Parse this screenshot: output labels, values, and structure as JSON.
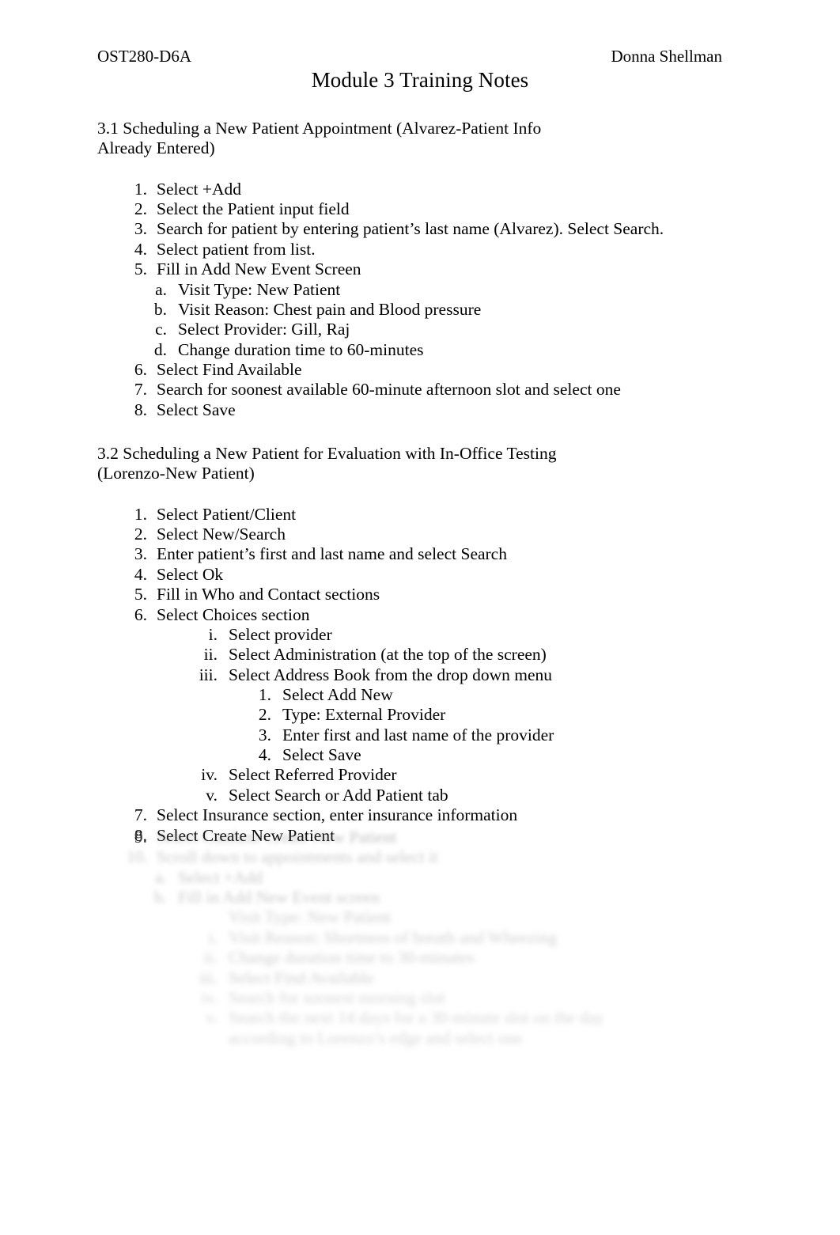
{
  "header": {
    "course_code": "OST280-D6A",
    "author": "Donna Shellman",
    "title": "Module 3 Training Notes"
  },
  "sections": [
    {
      "id": "3.1",
      "heading": "3.1 Scheduling a New Patient Appointment (Alvarez-Patient Info Already Entered)",
      "items": [
        {
          "marker": "1.",
          "text": "Select +Add"
        },
        {
          "marker": "2.",
          "text": "Select the Patient input field"
        },
        {
          "marker": "3.",
          "text": "Search for patient by entering patient’s last name (Alvarez). Select Search."
        },
        {
          "marker": "4.",
          "text": "Select patient from list."
        },
        {
          "marker": "5.",
          "text": "Fill in Add New Event Screen"
        }
      ],
      "sub_items": [
        {
          "marker": "a.",
          "text": "Visit Type: New Patient"
        },
        {
          "marker": "b.",
          "text": "Visit Reason: Chest pain and Blood pressure"
        },
        {
          "marker": "c.",
          "text": "Select Provider: Gill, Raj"
        },
        {
          "marker": "d.",
          "text": "Change duration time to 60-minutes"
        }
      ],
      "items_after": [
        {
          "marker": "6.",
          "text": "Select Find Available"
        },
        {
          "marker": "7.",
          "text": "Search for soonest available 60-minute afternoon slot and select one"
        },
        {
          "marker": "8.",
          "text": "Select Save"
        }
      ]
    },
    {
      "id": "3.2",
      "heading": "3.2 Scheduling a New Patient for Evaluation with In-Office Testing (Lorenzo-New Patient)",
      "items": [
        {
          "marker": "1.",
          "text": "Select Patient/Client"
        },
        {
          "marker": "2.",
          "text": "Select New/Search"
        },
        {
          "marker": "3.",
          "text": "Enter patient’s first and last name and select Search"
        },
        {
          "marker": "4.",
          "text": "Select Ok"
        },
        {
          "marker": "5.",
          "text": "Fill in Who and Contact sections"
        },
        {
          "marker": "6.",
          "text": "Select Choices section"
        }
      ],
      "roman_items": [
        {
          "marker": "i.",
          "text": "Select provider"
        },
        {
          "marker": "ii.",
          "text": "Select Administration (at the top of the screen)"
        },
        {
          "marker": "iii.",
          "text": "Select Address Book from the drop down menu"
        }
      ],
      "deep_items": [
        {
          "marker": "1.",
          "text": "Select Add New"
        },
        {
          "marker": "2.",
          "text": "Type: External Provider"
        },
        {
          "marker": "3.",
          "text": "Enter first and last name of the provider"
        },
        {
          "marker": "4.",
          "text": "Select Save"
        }
      ],
      "roman_items_after": [
        {
          "marker": "iv.",
          "text": "Select Referred Provider"
        },
        {
          "marker": "v.",
          "text": "Select Search or Add Patient tab"
        }
      ],
      "items_after": [
        {
          "marker": "7.",
          "text": "Select Insurance section, enter insurance information"
        },
        {
          "marker": "8.",
          "text": "Select Create New Patient"
        },
        {
          "marker": "9.",
          "text": ""
        }
      ]
    }
  ],
  "faded_block": {
    "note": "illegible faded text",
    "lines": [
      {
        "marker": "9.",
        "text": "Select Confirm Create New Patient",
        "indent": 1,
        "blur": 1
      },
      {
        "marker": "10.",
        "text": "Scroll down to appointments and select it",
        "indent": 1,
        "blur": 2
      },
      {
        "marker": "a.",
        "text": "Select +Add",
        "indent": 2,
        "blur": 2
      },
      {
        "marker": "b.",
        "text": "Fill in Add New Event screen",
        "indent": 2,
        "blur": 2
      },
      {
        "marker": "",
        "text": "Visit Type: New Patient",
        "indent": 3,
        "blur": 3
      },
      {
        "marker": "i.",
        "text": "Visit Reason: Shortness of breath and Wheezing",
        "indent": 3,
        "blur": 3
      },
      {
        "marker": "ii.",
        "text": "Change duration time to 30-minutes",
        "indent": 3,
        "blur": 3
      },
      {
        "marker": "iii.",
        "text": "Select Find Available",
        "indent": 3,
        "blur": 3
      },
      {
        "marker": "iv.",
        "text": "Search for soonest morning slot",
        "indent": 3,
        "blur": 4
      },
      {
        "marker": "v.",
        "text": "Search the next 14 days for a 30-minute slot on the day",
        "indent": 3,
        "blur": 4
      },
      {
        "marker": "",
        "text": "according to Lorenzo’s edge and select one",
        "indent": 3,
        "blur": 4
      }
    ]
  }
}
